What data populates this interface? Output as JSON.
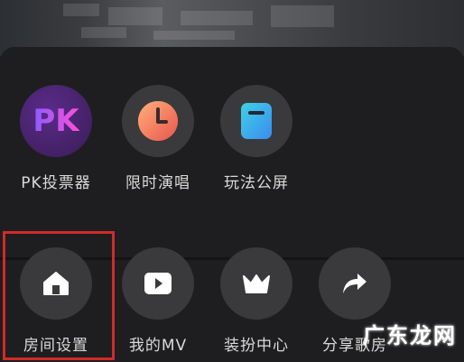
{
  "menu": {
    "row1": [
      {
        "label": "PK投票器",
        "icon": "pk-icon"
      },
      {
        "label": "限时演唱",
        "icon": "clock-icon"
      },
      {
        "label": "玩法公屏",
        "icon": "screen-icon"
      }
    ],
    "row2": [
      {
        "label": "房间设置",
        "icon": "home-icon"
      },
      {
        "label": "我的MV",
        "icon": "play-icon"
      },
      {
        "label": "装扮中心",
        "icon": "crown-icon"
      },
      {
        "label": "分享歌房",
        "icon": "share-icon"
      }
    ]
  },
  "pk_icon_text": "PK",
  "watermark": "广东龙网",
  "colors": {
    "highlight": "#d12a2a",
    "circle": "#3a3a3c",
    "background": "#1e1e20"
  }
}
